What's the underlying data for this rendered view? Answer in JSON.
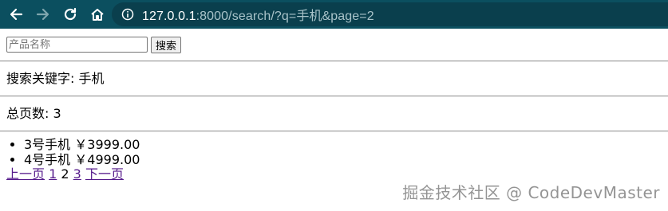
{
  "browser": {
    "url_host": "127.0.0.1",
    "url_rest": ":8000/search/?q=手机&page=2",
    "icons": [
      "back-icon",
      "forward-icon",
      "reload-icon",
      "home-icon",
      "info-icon"
    ]
  },
  "search": {
    "placeholder": "产品名称",
    "value": "",
    "button_label": "搜索"
  },
  "keyword_line": "搜索关键字: 手机",
  "total_pages_line": "总页数: 3",
  "products": [
    {
      "name": "3号手机",
      "price": "￥3999.00"
    },
    {
      "name": "4号手机",
      "price": "￥4999.00"
    }
  ],
  "pagination": {
    "prev": "上一页",
    "pages": [
      "1",
      "2",
      "3"
    ],
    "current": "2",
    "next": "下一页"
  },
  "watermark": "掘金技术社区 @ CodeDevMaster"
}
